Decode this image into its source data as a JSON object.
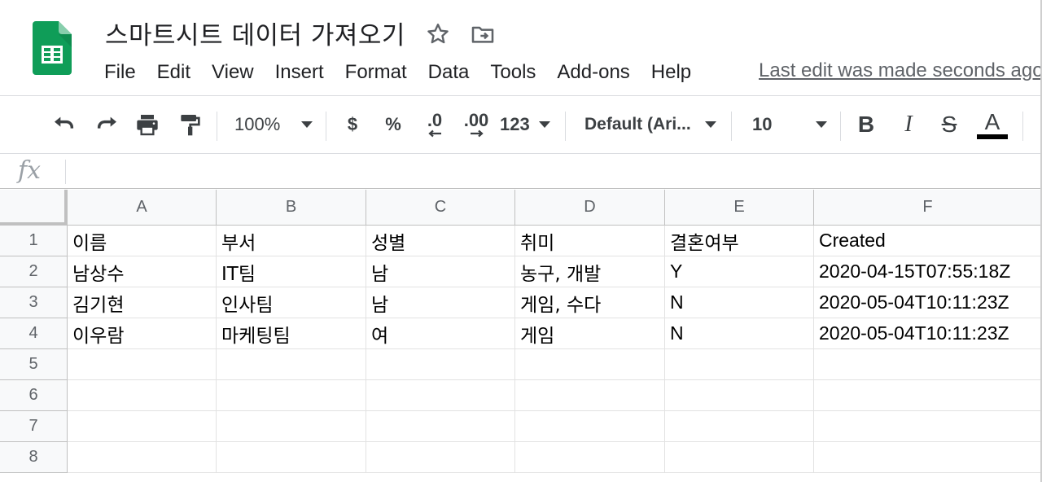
{
  "app": {
    "doc_title": "스마트시트 데이터 가져오기",
    "menu": [
      "File",
      "Edit",
      "View",
      "Insert",
      "Format",
      "Data",
      "Tools",
      "Add-ons",
      "Help"
    ],
    "last_edit": "Last edit was made seconds ago",
    "brand_color": "#0F9D58"
  },
  "toolbar": {
    "zoom": "100%",
    "currency": "$",
    "percent": "%",
    "decrease_decimal": ".0",
    "increase_decimal": ".00",
    "more_formats": "123",
    "font_family": "Default (Ari...",
    "font_size": "10",
    "bold": "B",
    "italic": "I",
    "strike": "S",
    "text_color": "A",
    "icons": [
      "undo-icon",
      "redo-icon",
      "print-icon",
      "paint-format-icon"
    ]
  },
  "formula_bar": {
    "fx_label": "fx",
    "value": ""
  },
  "sheet": {
    "columns": [
      "A",
      "B",
      "C",
      "D",
      "E",
      "F"
    ],
    "row_numbers": [
      "1",
      "2",
      "3",
      "4",
      "5",
      "6",
      "7",
      "8"
    ],
    "rows": [
      [
        "이름",
        "부서",
        "성별",
        "취미",
        "결혼여부",
        "Created"
      ],
      [
        "남상수",
        "IT팀",
        "남",
        "농구, 개발",
        "Y",
        "2020-04-15T07:55:18Z"
      ],
      [
        "김기현",
        "인사팀",
        "남",
        "게임, 수다",
        "N",
        "2020-05-04T10:11:23Z"
      ],
      [
        "이우람",
        "마케팅팀",
        "여",
        "게임",
        "N",
        "2020-05-04T10:11:23Z"
      ],
      [
        "",
        "",
        "",
        "",
        "",
        ""
      ],
      [
        "",
        "",
        "",
        "",
        "",
        ""
      ],
      [
        "",
        "",
        "",
        "",
        "",
        ""
      ],
      [
        "",
        "",
        "",
        "",
        "",
        ""
      ]
    ]
  }
}
